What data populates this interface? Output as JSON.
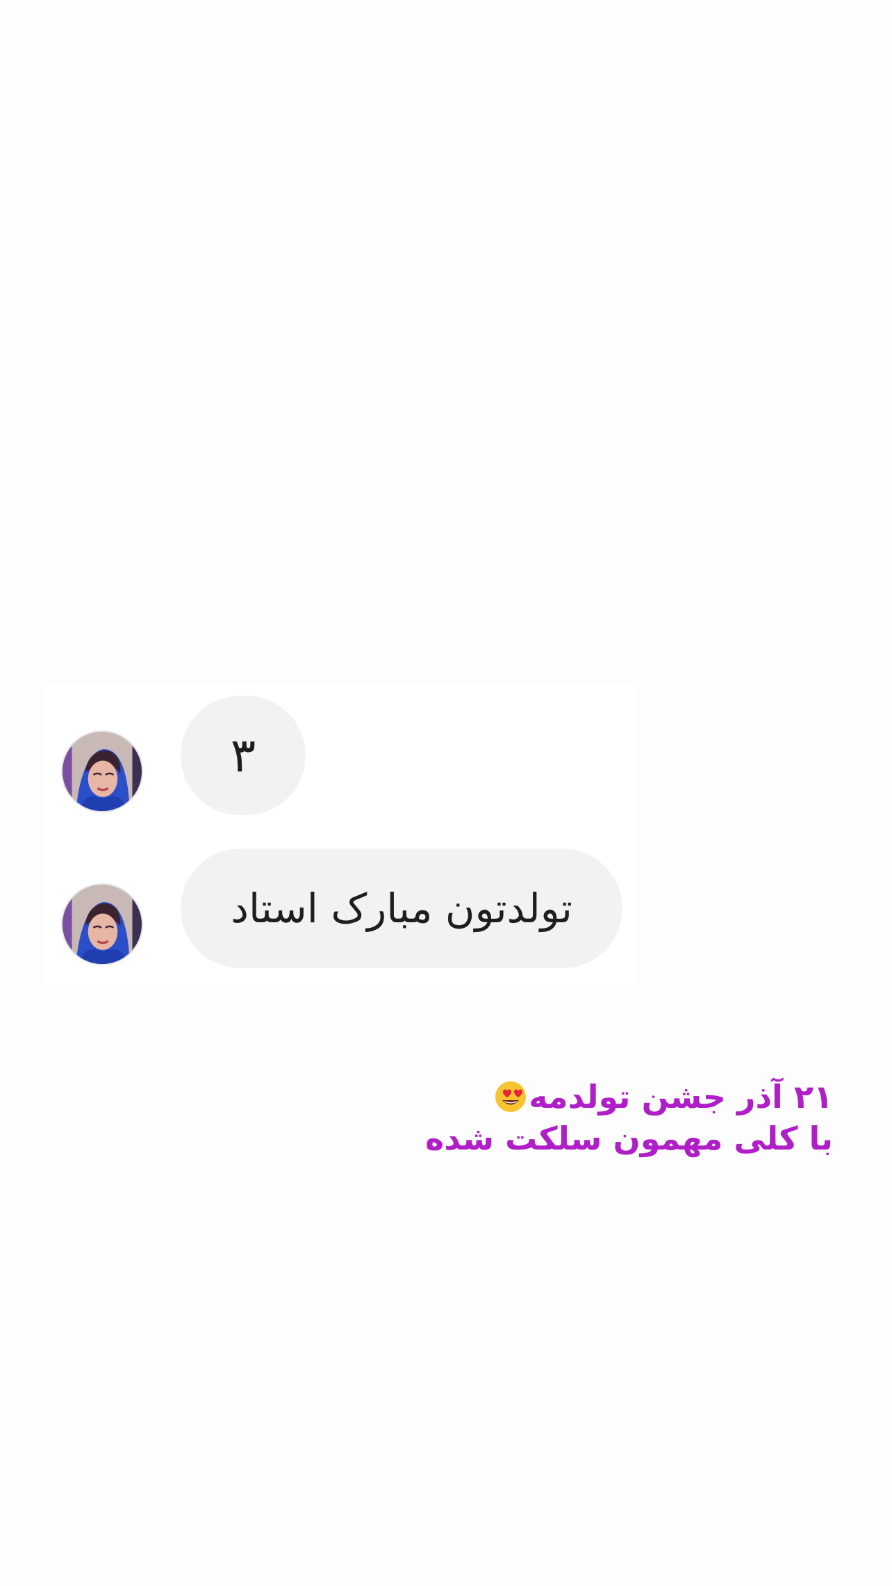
{
  "chat": {
    "messages": [
      {
        "text": "۳"
      },
      {
        "text": "تولدتون مبارک استاد"
      }
    ]
  },
  "caption": {
    "line1": "۲۱ آذر جشن تولدمه",
    "line1_emoji": "heart-eyes-emoji",
    "line2": "با کلی مهمون سلکت شده"
  },
  "colors": {
    "caption": "#b01ec8",
    "bubble": "#f1f2f4",
    "background": "#fdfdfd"
  }
}
